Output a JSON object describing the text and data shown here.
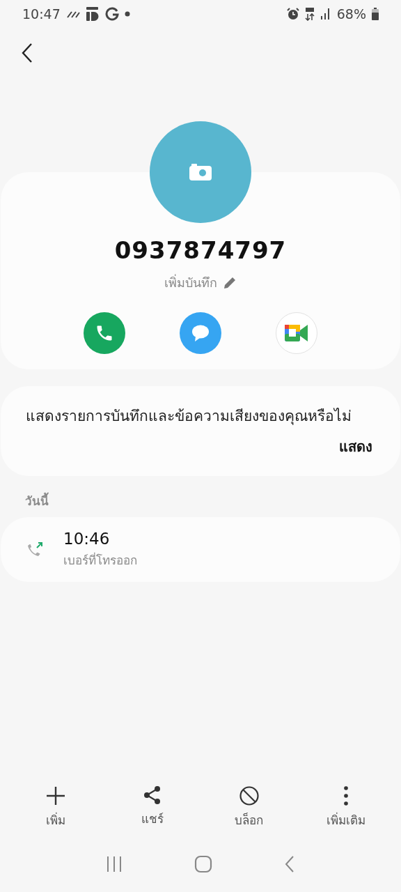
{
  "status_bar": {
    "time": "10:47",
    "battery": "68%"
  },
  "contact": {
    "number": "0937874797",
    "note_label": "เพิ่มบันทึก"
  },
  "actions": [
    {
      "kind": "call"
    },
    {
      "kind": "message"
    },
    {
      "kind": "video"
    }
  ],
  "voicemail_prompt": {
    "text": "แสดงรายการบันทึกและข้อความเสียงของคุณหรือไม่",
    "button": "แสดง"
  },
  "history": {
    "section": "วันนี้",
    "entries": [
      {
        "kind": "outgoing",
        "time": "10:46",
        "label": "เบอร์ที่โทรออก"
      }
    ]
  },
  "toolbar": [
    {
      "kind": "add",
      "label": "เพิ่ม"
    },
    {
      "kind": "share",
      "label": "แชร์"
    },
    {
      "kind": "block",
      "label": "บล็อก"
    },
    {
      "kind": "more",
      "label": "เพิ่มเติม"
    }
  ]
}
